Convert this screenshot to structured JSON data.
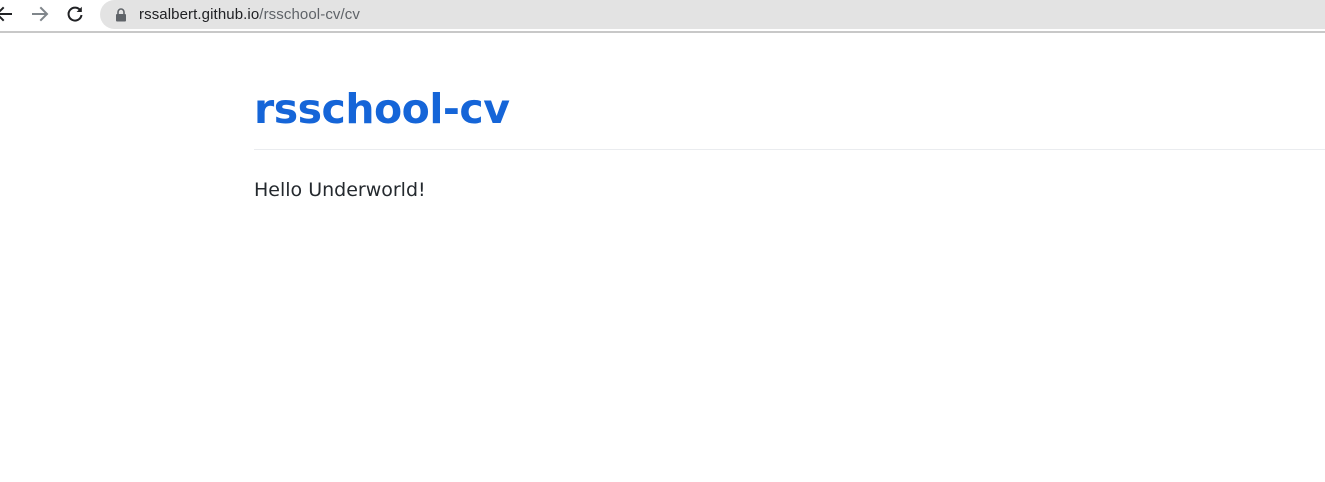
{
  "browser": {
    "url_host": "rssalbert.github.io",
    "url_path": "/rsschool-cv/cv",
    "icons": {
      "back": "back-arrow-icon",
      "forward": "forward-arrow-icon",
      "reload": "reload-icon",
      "lock": "lock-icon"
    }
  },
  "page": {
    "title": "rsschool-cv",
    "body_text": "Hello Underworld!"
  },
  "colors": {
    "title": "#1565d8",
    "text": "#24292e",
    "omnibox": "#e3e3e3"
  }
}
